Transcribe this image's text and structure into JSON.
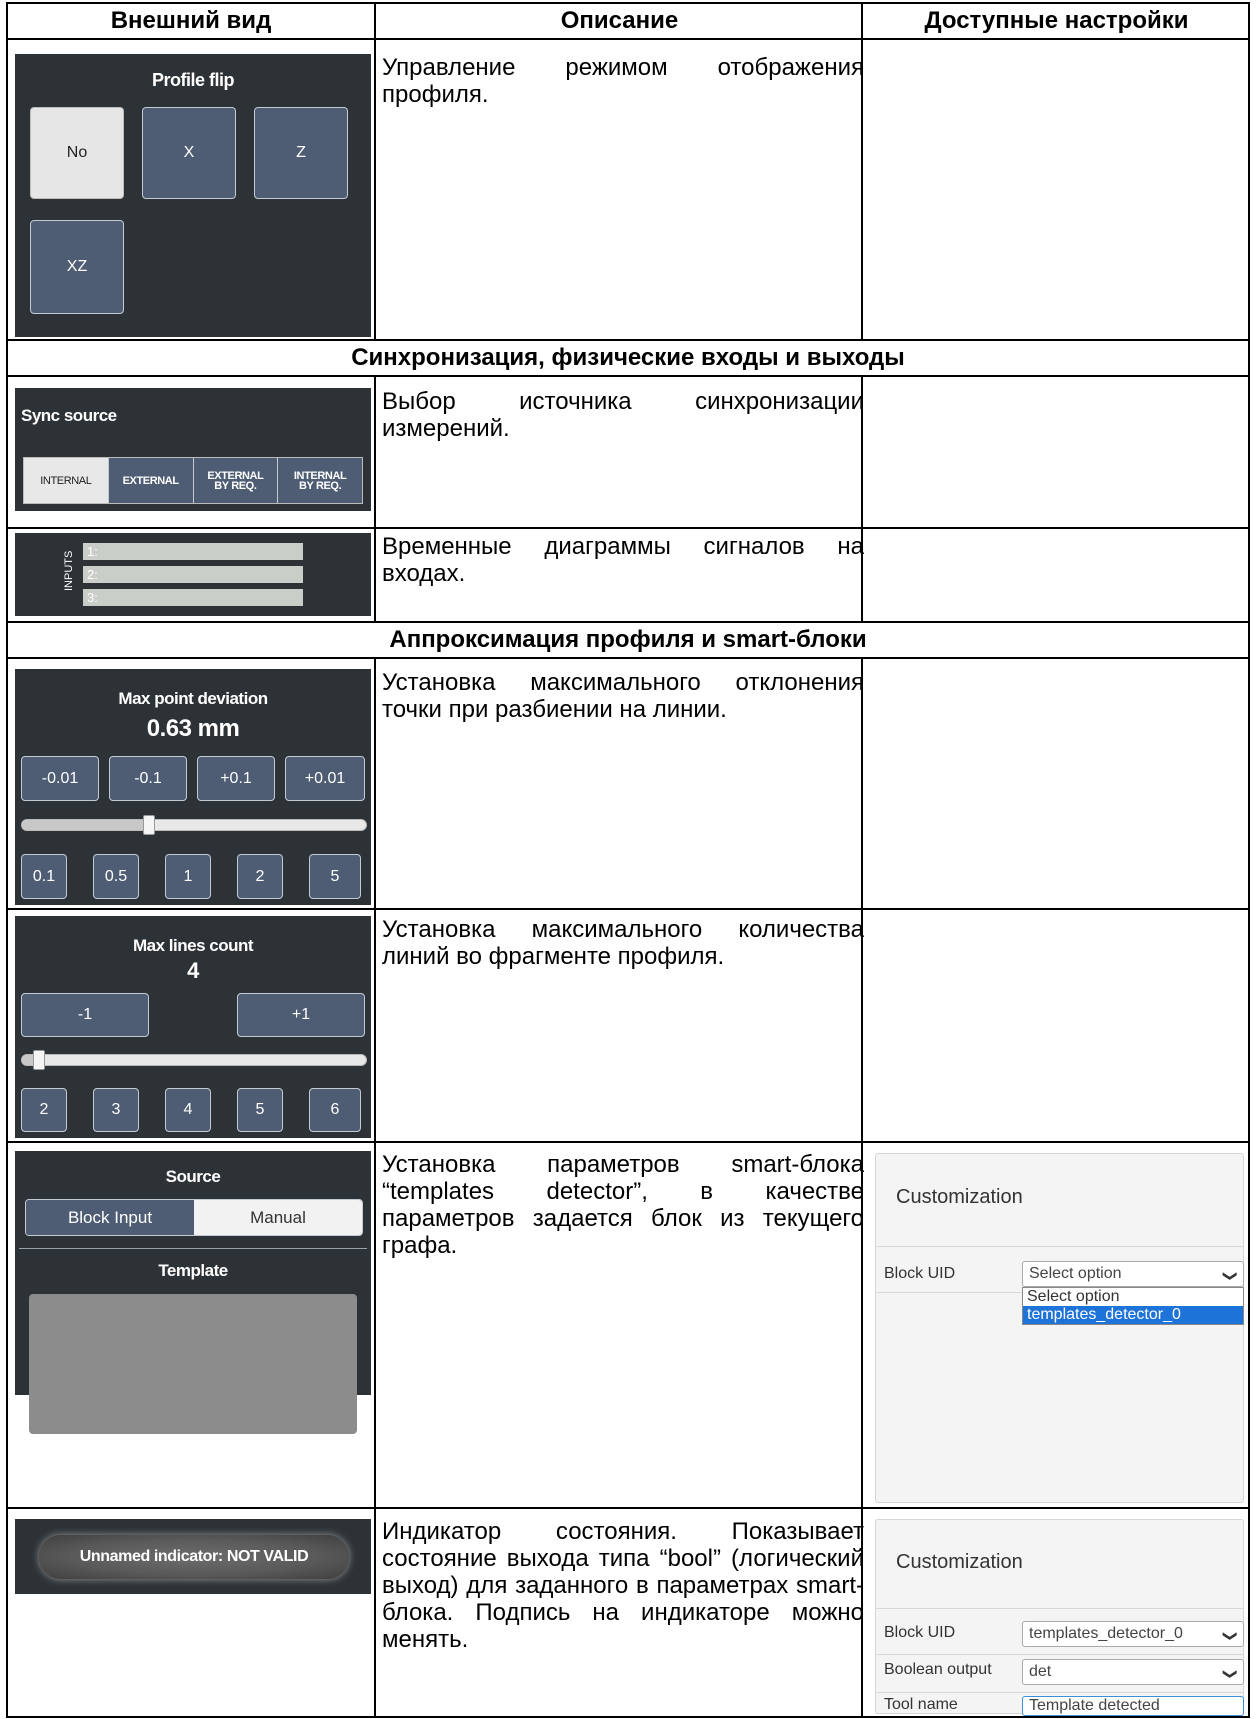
{
  "headers": [
    "Внешний вид",
    "Описание",
    "Доступные настройки"
  ],
  "sections": [
    "Синхронизация, физические входы и выходы",
    "Аппроксимация профиля и smart-блоки"
  ],
  "rows": {
    "profile_flip": {
      "title": "Profile flip",
      "buttons": [
        "No",
        "X",
        "Z",
        "XZ"
      ],
      "active": "No",
      "desc": "Управление режимом отображения профиля."
    },
    "sync_source": {
      "title": "Sync source",
      "options": [
        "INTERNAL",
        "EXTERNAL",
        "EXTERNAL BY REQ.",
        "INTERNAL BY REQ."
      ],
      "active": "INTERNAL",
      "desc": "Выбор источника синхронизации измерений."
    },
    "inputs": {
      "label": "INPUTS",
      "channels": [
        "1:",
        "2:",
        "3:"
      ],
      "desc": "Временные диаграммы сигналов на входах."
    },
    "max_point_deviation": {
      "title": "Max point deviation",
      "value": "0.63 mm",
      "step_buttons": [
        "-0.01",
        "-0.1",
        "+0.1",
        "+0.01"
      ],
      "preset_buttons": [
        "0.1",
        "0.5",
        "1",
        "2",
        "5"
      ],
      "slider_fraction": 0.37,
      "desc": "Установка максимального отклонения точки при разбиении на линии."
    },
    "max_lines_count": {
      "title": "Max lines count",
      "value": "4",
      "step_buttons": [
        "-1",
        "+1"
      ],
      "preset_buttons": [
        "2",
        "3",
        "4",
        "5",
        "6"
      ],
      "slider_fraction": 0.05,
      "desc": "Установка максимального количества линий во фрагменте профиля."
    },
    "templates_detector": {
      "source_title": "Source",
      "source_options": [
        "Block Input",
        "Manual"
      ],
      "source_active": "Block Input",
      "template_title": "Template",
      "desc": "Установка параметров smart-блока “templates detector”, в качестве параметров задается блок из текущего графа.",
      "customization": {
        "title": "Customization",
        "block_uid_label": "Block UID",
        "block_uid_value": "Select option",
        "dropdown_options": [
          "Select option",
          "templates_detector_0"
        ],
        "dropdown_selected": "templates_detector_0"
      }
    },
    "indicator": {
      "label": "Unnamed indicator: NOT VALID",
      "desc": "Индикатор состояния. Показывает состояние выхода типа “bool” (логический выход) для заданного в параметрах smart-блока. Подпись на индикаторе можно менять.",
      "customization": {
        "title": "Customization",
        "block_uid_label": "Block UID",
        "block_uid_value": "templates_detector_0",
        "bool_output_label": "Boolean output",
        "bool_output_value": "det",
        "tool_name_label": "Tool name",
        "tool_name_value": "Template detected"
      }
    }
  },
  "colors": {
    "panel_bg": "#2c3236",
    "button_bg": "#4e5d73",
    "active_bg": "#e6e6e6",
    "select_highlight": "#1e73d8"
  }
}
